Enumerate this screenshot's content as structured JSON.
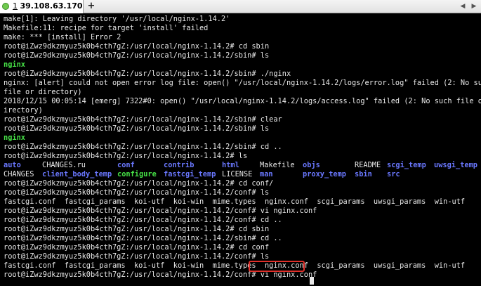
{
  "tab": {
    "number": "1",
    "host": "39.108.63.170",
    "new_tab": "+",
    "nav_left": "◀",
    "nav_right": "▶"
  },
  "terminal": {
    "lines": [
      "make[1]: Leaving directory '/usr/local/nginx-1.14.2'",
      "Makefile:11: recipe for target 'install' failed",
      "make: *** [install] Error 2",
      "root@iZwz9dkzmyuz5k0b4cth7gZ:/usr/local/nginx-1.14.2# cd sbin",
      "root@iZwz9dkzmyuz5k0b4cth7gZ:/usr/local/nginx-1.14.2/sbin# ls",
      "nginx",
      "root@iZwz9dkzmyuz5k0b4cth7gZ:/usr/local/nginx-1.14.2/sbin# ./nginx",
      "nginx: [alert] could not open error log file: open() \"/usr/local/nginx-1.14.2/logs/error.log\" failed (2: No such",
      "file or directory)",
      "2018/12/15 00:05:14 [emerg] 7322#0: open() \"/usr/local/nginx-1.14.2/logs/access.log\" failed (2: No such file or d",
      "irectory)",
      "root@iZwz9dkzmyuz5k0b4cth7gZ:/usr/local/nginx-1.14.2/sbin# clear",
      "root@iZwz9dkzmyuz5k0b4cth7gZ:/usr/local/nginx-1.14.2/sbin# ls",
      "nginx",
      "root@iZwz9dkzmyuz5k0b4cth7gZ:/usr/local/nginx-1.14.2/sbin# cd ..",
      "root@iZwz9dkzmyuz5k0b4cth7gZ:/usr/local/nginx-1.14.2# ls",
      "",
      "",
      "root@iZwz9dkzmyuz5k0b4cth7gZ:/usr/local/nginx-1.14.2# cd conf/",
      "root@iZwz9dkzmyuz5k0b4cth7gZ:/usr/local/nginx-1.14.2/conf# ls",
      "fastcgi.conf  fastcgi_params  koi-utf  koi-win  mime.types  nginx.conf  scgi_params  uwsgi_params  win-utf",
      "root@iZwz9dkzmyuz5k0b4cth7gZ:/usr/local/nginx-1.14.2/conf# vi nginx.conf",
      "root@iZwz9dkzmyuz5k0b4cth7gZ:/usr/local/nginx-1.14.2/conf# cd ..",
      "root@iZwz9dkzmyuz5k0b4cth7gZ:/usr/local/nginx-1.14.2# cd sbin",
      "root@iZwz9dkzmyuz5k0b4cth7gZ:/usr/local/nginx-1.14.2/sbin# cd ..",
      "root@iZwz9dkzmyuz5k0b4cth7gZ:/usr/local/nginx-1.14.2# cd conf",
      "root@iZwz9dkzmyuz5k0b4cth7gZ:/usr/local/nginx-1.14.2/conf# ls",
      "fastcgi.conf  fastcgi_params  koi-utf  koi-win  mime.types  nginx.conf  scgi_params  uwsgi_params  win-utf",
      "root@iZwz9dkzmyuz5k0b4cth7gZ:/usr/local/nginx-1.14.2/conf# vi nginx.conf"
    ],
    "bold_line_indexes": [
      5,
      13
    ],
    "listing_row_1": [
      {
        "text": "auto",
        "style": "blue"
      },
      {
        "text": "CHANGES.ru",
        "style": "plain"
      },
      {
        "text": "conf",
        "style": "blue"
      },
      {
        "text": "contrib",
        "style": "blue"
      },
      {
        "text": "html",
        "style": "blue"
      },
      {
        "text": "Makefile",
        "style": "plain"
      },
      {
        "text": "objs",
        "style": "blue"
      },
      {
        "text": "README",
        "style": "plain"
      },
      {
        "text": "scgi_temp",
        "style": "blue"
      },
      {
        "text": "uwsgi_temp",
        "style": "blue"
      }
    ],
    "listing_row_2": [
      {
        "text": "CHANGES",
        "style": "plain"
      },
      {
        "text": "client_body_temp",
        "style": "blue"
      },
      {
        "text": "configure",
        "style": "green"
      },
      {
        "text": "fastcgi_temp",
        "style": "blue"
      },
      {
        "text": "LICENSE",
        "style": "plain"
      },
      {
        "text": "man",
        "style": "blue"
      },
      {
        "text": "proxy_temp",
        "style": "blue"
      },
      {
        "text": "sbin",
        "style": "blue"
      },
      {
        "text": "src",
        "style": "blue"
      }
    ],
    "highlighted_file": "nginx.conf",
    "colors": {
      "background": "#000000",
      "foreground": "#e8e8e8",
      "directory": "#6a78ff",
      "executable": "#46e046",
      "highlight": "#e0302a"
    }
  }
}
